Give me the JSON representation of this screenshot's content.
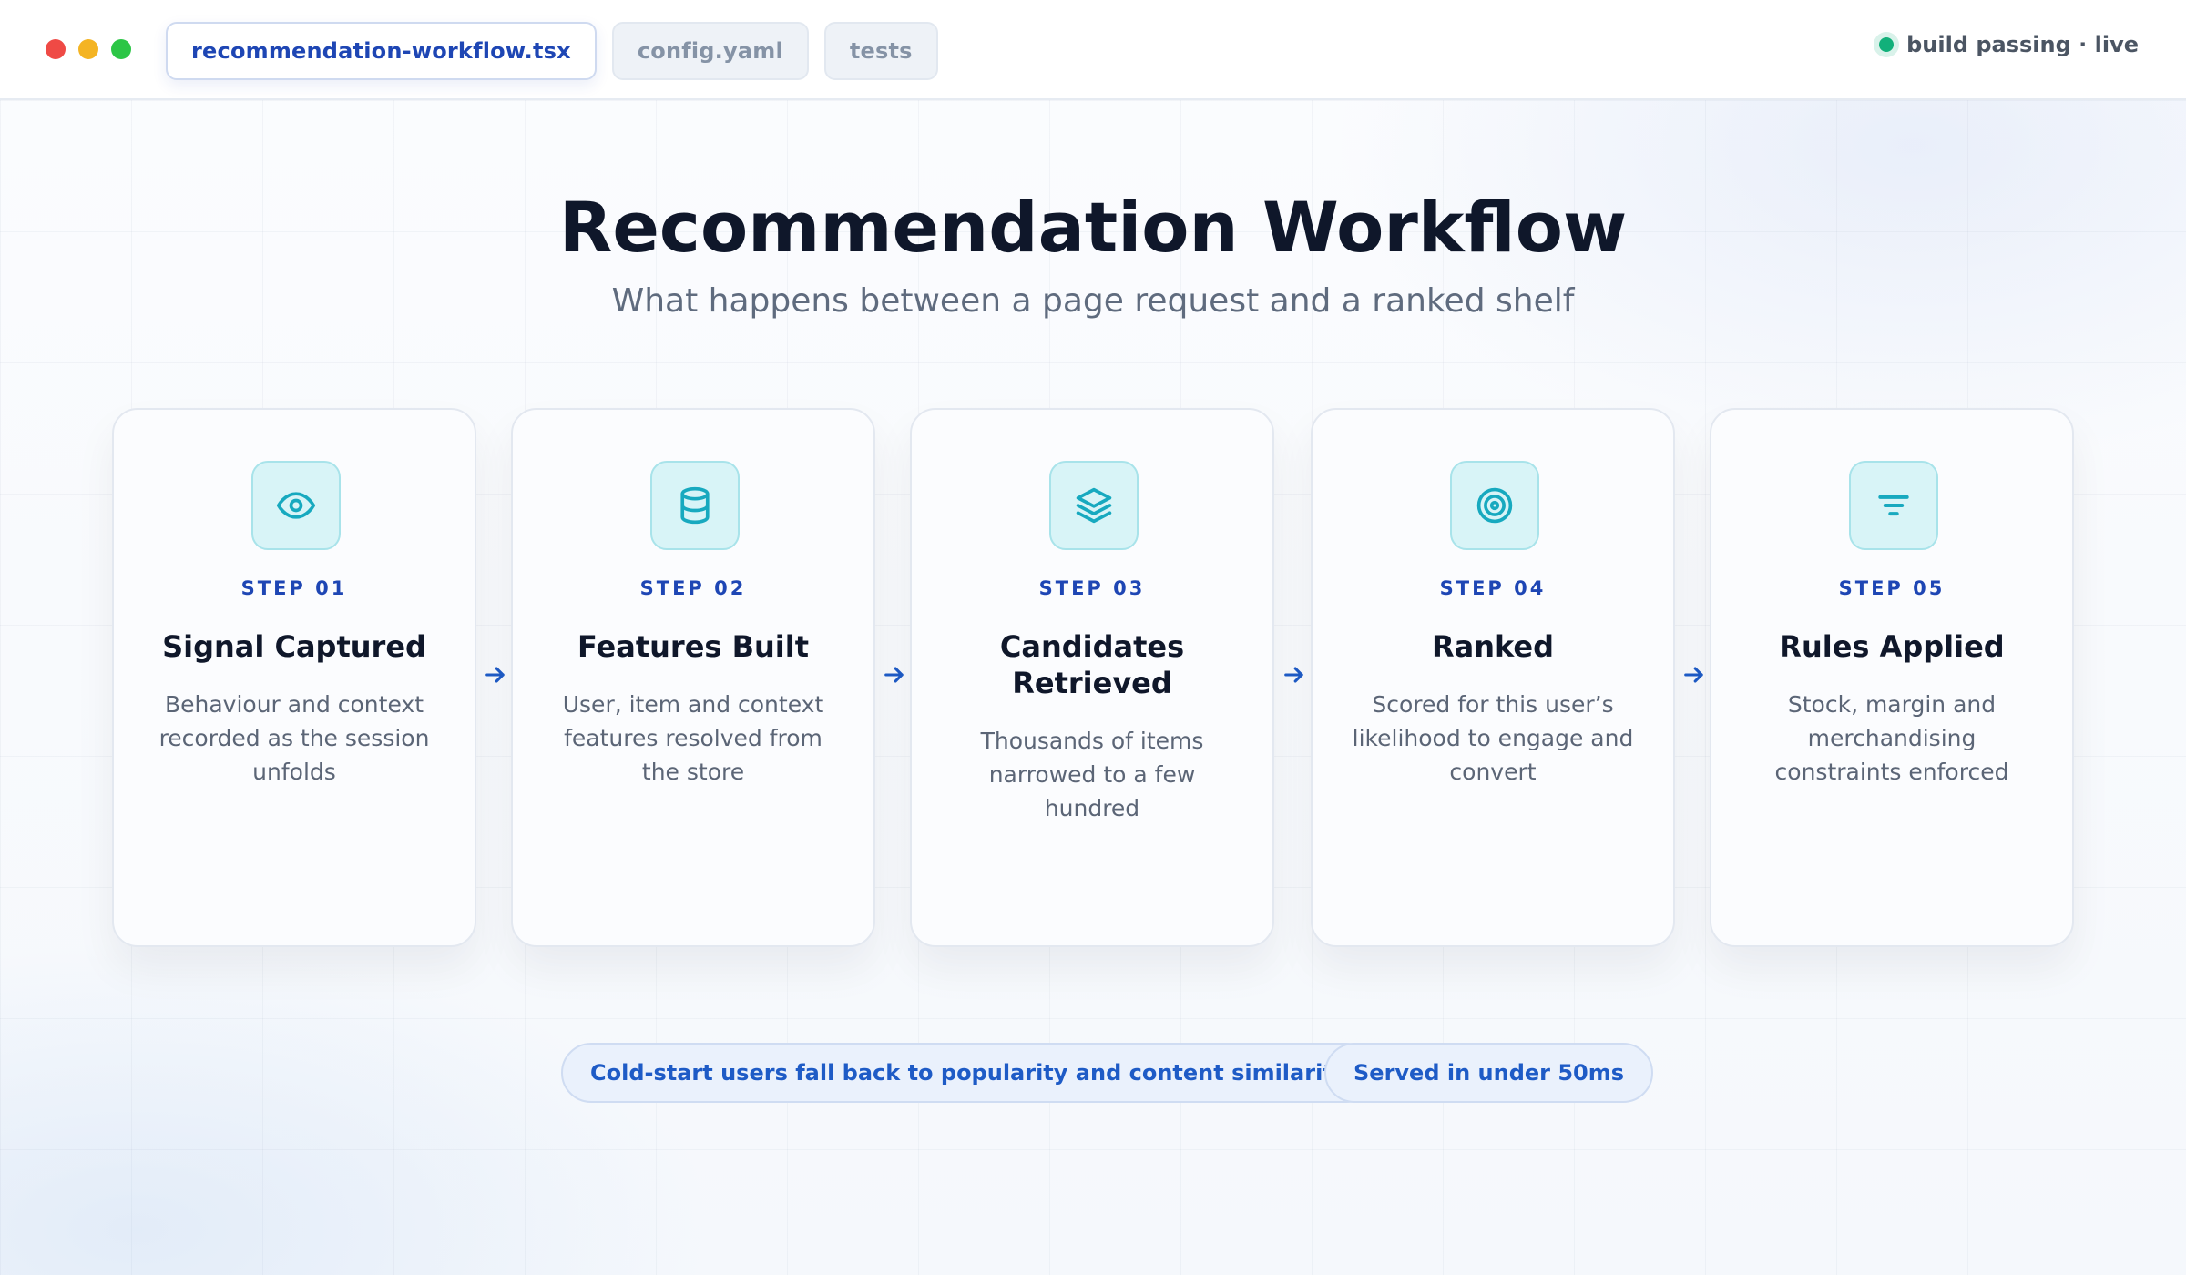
{
  "window": {
    "controls": [
      "close",
      "minimize",
      "maximize"
    ],
    "tabs": [
      {
        "label": "recommendation-workflow.tsx",
        "active": true
      },
      {
        "label": "config.yaml",
        "active": false
      },
      {
        "label": "tests",
        "active": false
      }
    ],
    "status": {
      "text": "build passing · live",
      "color": "#12b07a"
    }
  },
  "header": {
    "title": "Recommendation Workflow",
    "subtitle": "What happens between a page request and a ranked shelf"
  },
  "steps": [
    {
      "label": "STEP 01",
      "title": "Signal Captured",
      "description": "Behaviour and context recorded as the session unfolds",
      "icon": "eye-icon"
    },
    {
      "label": "STEP 02",
      "title": "Features Built",
      "description": "User, item and context features resolved from the store",
      "icon": "database-icon"
    },
    {
      "label": "STEP 03",
      "title": "Candidates Retrieved",
      "description": "Thousands of items narrowed to a few hundred",
      "icon": "layers-icon"
    },
    {
      "label": "STEP 04",
      "title": "Ranked",
      "description": "Scored for this user’s likelihood to engage and convert",
      "icon": "target-icon"
    },
    {
      "label": "STEP 05",
      "title": "Rules Applied",
      "description": "Stock, margin and merchandising constraints enforced",
      "icon": "filter-icon"
    }
  ],
  "footer": {
    "notes": [
      "Cold-start users fall back to popularity and content similarity",
      "Served in under 50ms"
    ]
  },
  "colors": {
    "accent": "#1e46b4",
    "icon_teal": "#17a9bf",
    "icon_bg": "#d8f4f7"
  }
}
